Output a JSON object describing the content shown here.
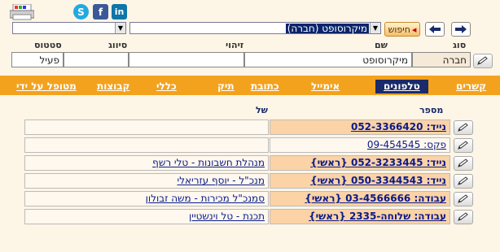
{
  "social": {
    "skype": "S",
    "facebook": "f",
    "linkedin": "in"
  },
  "toolbar": {
    "search_label": "חיפוש",
    "entity_value": "מיקרוסופט (חברה)"
  },
  "header": {
    "col_type": "סוג",
    "col_name": "שם",
    "col_id": "זיהוי",
    "col_class": "סיווג",
    "col_status": "סטטוס",
    "type_value": "חברה",
    "name_value": "מיקרוסופט",
    "id_value": "",
    "class_value": "",
    "status_value": "פעיל"
  },
  "tabs": [
    {
      "label": "קשרים"
    },
    {
      "label": "טלפונים"
    },
    {
      "label": "אימייל"
    },
    {
      "label": "כתובת"
    },
    {
      "label": "תיק"
    },
    {
      "label": "כללי"
    },
    {
      "label": "קבוצות"
    },
    {
      "label": "מטופל על ידי"
    }
  ],
  "table": {
    "col_number": "מספר",
    "col_owner": "של",
    "rows": [
      {
        "number": "נייד: 052-3366420",
        "owner": "",
        "main": true
      },
      {
        "number": "פקס: 09-454545",
        "owner": "",
        "main": false
      },
      {
        "number": "נייד: 052-3233445 {ראשי}",
        "owner": "מנהלת חשבונות - טלי רשף",
        "main": true
      },
      {
        "number": "נייד: 050-3344543 {ראשי}",
        "owner": "מנכ\"ל - יוסף עזריאלי",
        "main": true
      },
      {
        "number": "עבודה: 03-4566666 {ראשי}",
        "owner": "סמנכ\"ל מכירות - משה זבולון",
        "main": true
      },
      {
        "number": "עבודה: שלוחה-2335 {ראשי}",
        "owner": "תכנת - טל וינשטיין",
        "main": true
      }
    ]
  },
  "colors": {
    "accent": "#f3a21e",
    "active_tab": "#1a2a6a",
    "highlight": "#fbd3a6"
  }
}
